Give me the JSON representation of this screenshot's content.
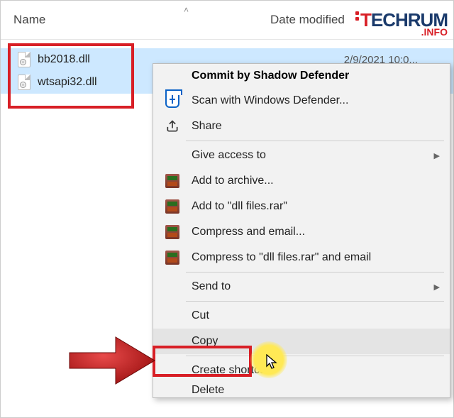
{
  "columns": {
    "name": "Name",
    "date": "Date modified"
  },
  "logo": {
    "brand_prefix": "T",
    "brand_rest": "ECHRUM",
    "suffix": ".INFO"
  },
  "files": [
    {
      "icon": "dll-icon",
      "name": "bb2018.dll",
      "date": "2/9/2021 10:0..."
    },
    {
      "icon": "dll-icon",
      "name": "wtsapi32.dll",
      "date": ""
    }
  ],
  "context_menu": {
    "header": "Commit by Shadow Defender",
    "scan": "Scan with Windows Defender...",
    "share": "Share",
    "give_access": "Give access to",
    "add_archive": "Add to archive...",
    "add_named": "Add to \"dll files.rar\"",
    "compress_email": "Compress and email...",
    "compress_named_email": "Compress to \"dll files.rar\" and email",
    "send_to": "Send to",
    "cut": "Cut",
    "copy": "Copy",
    "create_shortcut": "Create shortcut",
    "delete": "Delete"
  }
}
